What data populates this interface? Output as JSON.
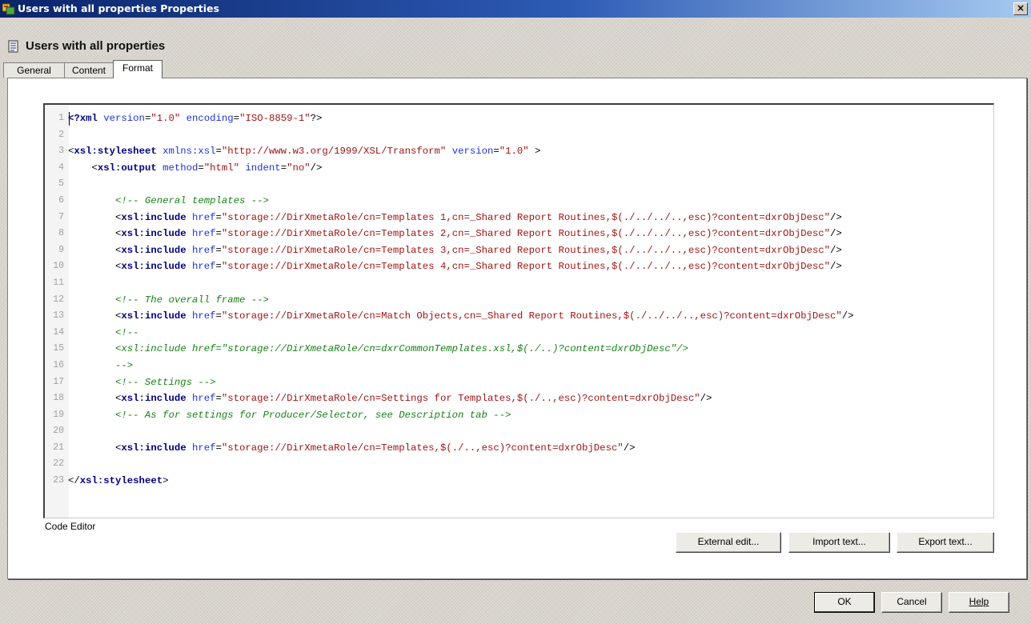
{
  "window": {
    "title": "Users with all properties Properties",
    "close_symbol": "×",
    "icon": "app-properties-icon"
  },
  "header": {
    "title": "Users with all properties",
    "icon": "document-icon"
  },
  "tabs": [
    {
      "label": "General",
      "active": false
    },
    {
      "label": "Content",
      "active": false
    },
    {
      "label": "Format",
      "active": true
    }
  ],
  "editor": {
    "label": "Code Editor",
    "lines": [
      {
        "n": "1",
        "tokens": [
          [
            "k",
            "<?xml"
          ],
          [
            "a",
            " version"
          ],
          [
            "p",
            "="
          ],
          [
            "v",
            "\"1.0\""
          ],
          [
            "a",
            " encoding"
          ],
          [
            "p",
            "="
          ],
          [
            "v",
            "\"ISO-8859-1\""
          ],
          [
            "p",
            "?>"
          ]
        ]
      },
      {
        "n": "2",
        "tokens": []
      },
      {
        "n": "3",
        "tokens": [
          [
            "p",
            "<"
          ],
          [
            "t",
            "xsl:stylesheet"
          ],
          [
            "a",
            " xmlns:xsl"
          ],
          [
            "p",
            "="
          ],
          [
            "v",
            "\"http://www.w3.org/1999/XSL/Transform\""
          ],
          [
            "a",
            " version"
          ],
          [
            "p",
            "="
          ],
          [
            "v",
            "\"1.0\""
          ],
          [
            "p",
            " >"
          ]
        ]
      },
      {
        "n": "4",
        "tokens": [
          [
            "p",
            "    <"
          ],
          [
            "t",
            "xsl:output"
          ],
          [
            "a",
            " method"
          ],
          [
            "p",
            "="
          ],
          [
            "v",
            "\"html\""
          ],
          [
            "a",
            " indent"
          ],
          [
            "p",
            "="
          ],
          [
            "v",
            "\"no\""
          ],
          [
            "p",
            "/>"
          ]
        ]
      },
      {
        "n": "5",
        "tokens": []
      },
      {
        "n": "6",
        "tokens": [
          [
            "c",
            "        <!-- General templates -->"
          ]
        ]
      },
      {
        "n": "7",
        "tokens": [
          [
            "p",
            "        <"
          ],
          [
            "t",
            "xsl:include"
          ],
          [
            "a",
            " href"
          ],
          [
            "p",
            "="
          ],
          [
            "v",
            "\"storage://DirXmetaRole/cn=Templates 1,cn=_Shared Report Routines,$(./../../..,esc)?content=dxrObjDesc\""
          ],
          [
            "p",
            "/>"
          ]
        ]
      },
      {
        "n": "8",
        "tokens": [
          [
            "p",
            "        <"
          ],
          [
            "t",
            "xsl:include"
          ],
          [
            "a",
            " href"
          ],
          [
            "p",
            "="
          ],
          [
            "v",
            "\"storage://DirXmetaRole/cn=Templates 2,cn=_Shared Report Routines,$(./../../..,esc)?content=dxrObjDesc\""
          ],
          [
            "p",
            "/>"
          ]
        ]
      },
      {
        "n": "9",
        "tokens": [
          [
            "p",
            "        <"
          ],
          [
            "t",
            "xsl:include"
          ],
          [
            "a",
            " href"
          ],
          [
            "p",
            "="
          ],
          [
            "v",
            "\"storage://DirXmetaRole/cn=Templates 3,cn=_Shared Report Routines,$(./../../..,esc)?content=dxrObjDesc\""
          ],
          [
            "p",
            "/>"
          ]
        ]
      },
      {
        "n": "10",
        "tokens": [
          [
            "p",
            "        <"
          ],
          [
            "t",
            "xsl:include"
          ],
          [
            "a",
            " href"
          ],
          [
            "p",
            "="
          ],
          [
            "v",
            "\"storage://DirXmetaRole/cn=Templates 4,cn=_Shared Report Routines,$(./../../..,esc)?content=dxrObjDesc\""
          ],
          [
            "p",
            "/>"
          ]
        ]
      },
      {
        "n": "11",
        "tokens": []
      },
      {
        "n": "12",
        "tokens": [
          [
            "c",
            "        <!-- The overall frame -->"
          ]
        ]
      },
      {
        "n": "13",
        "tokens": [
          [
            "p",
            "        <"
          ],
          [
            "t",
            "xsl:include"
          ],
          [
            "a",
            " href"
          ],
          [
            "p",
            "="
          ],
          [
            "v",
            "\"storage://DirXmetaRole/cn=Match Objects,cn=_Shared Report Routines,$(./../../..,esc)?content=dxrObjDesc\""
          ],
          [
            "p",
            "/>"
          ]
        ]
      },
      {
        "n": "14",
        "tokens": [
          [
            "c",
            "        <!--"
          ]
        ]
      },
      {
        "n": "15",
        "tokens": [
          [
            "c",
            "        <xsl:include href=\"storage://DirXmetaRole/cn=dxrCommonTemplates.xsl,$(./..)?content=dxrObjDesc\"/>"
          ]
        ]
      },
      {
        "n": "16",
        "tokens": [
          [
            "c",
            "        -->"
          ]
        ]
      },
      {
        "n": "17",
        "tokens": [
          [
            "c",
            "        <!-- Settings -->"
          ]
        ]
      },
      {
        "n": "18",
        "tokens": [
          [
            "p",
            "        <"
          ],
          [
            "t",
            "xsl:include"
          ],
          [
            "a",
            " href"
          ],
          [
            "p",
            "="
          ],
          [
            "v",
            "\"storage://DirXmetaRole/cn=Settings for Templates,$(./..,esc)?content=dxrObjDesc\""
          ],
          [
            "p",
            "/>"
          ]
        ]
      },
      {
        "n": "19",
        "tokens": [
          [
            "c",
            "        <!-- As for settings for Producer/Selector, see Description tab -->"
          ]
        ]
      },
      {
        "n": "20",
        "tokens": []
      },
      {
        "n": "21",
        "tokens": [
          [
            "p",
            "        <"
          ],
          [
            "t",
            "xsl:include"
          ],
          [
            "a",
            " href"
          ],
          [
            "p",
            "="
          ],
          [
            "v",
            "\"storage://DirXmetaRole/cn=Templates,$(./..,esc)?content=dxrObjDesc\""
          ],
          [
            "p",
            "/>"
          ]
        ]
      },
      {
        "n": "22",
        "tokens": []
      },
      {
        "n": "23",
        "tokens": [
          [
            "p",
            "</"
          ],
          [
            "t",
            "xsl:stylesheet"
          ],
          [
            "p",
            ">"
          ]
        ]
      }
    ]
  },
  "editor_buttons": {
    "external_edit": "External edit...",
    "import_text": "Import text...",
    "export_text": "Export text..."
  },
  "footer": {
    "ok": "OK",
    "cancel": "Cancel",
    "help": "Help"
  }
}
